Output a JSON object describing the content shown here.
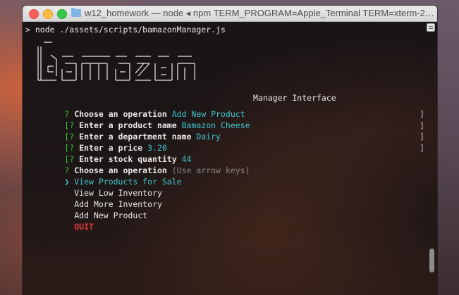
{
  "window": {
    "title": "w12_homework — node ◂ npm TERM_PROGRAM=Apple_Terminal TERM=xterm-2…"
  },
  "terminal": {
    "command_line": "> node ./assets/scripts/bamazonManager.js",
    "banner_logo_text": "Bamazon",
    "banner_subtitle": "Manager Interface",
    "lines": [
      {
        "prefix": "? ",
        "label": "Choose an operation ",
        "answer": "Add New Product"
      },
      {
        "prefix": "[? ",
        "label": "Enter a product name ",
        "answer": "Bamazon Cheese",
        "suffix": "]"
      },
      {
        "prefix": "[? ",
        "label": "Enter a department name ",
        "answer": "Dairy",
        "suffix": "]"
      },
      {
        "prefix": "[? ",
        "label": "Enter a price ",
        "answer": "3.20",
        "suffix": "]"
      },
      {
        "prefix": "[? ",
        "label": "Enter stock quantity ",
        "answer": "44",
        "suffix": "]"
      }
    ],
    "prompt": {
      "prefix": "? ",
      "label": "Choose an operation ",
      "hint": "(Use arrow keys)"
    },
    "menu": [
      {
        "pointer": "❯ ",
        "label": "View Products for Sale",
        "selected": true
      },
      {
        "pointer": "  ",
        "label": "View Low Inventory",
        "selected": false
      },
      {
        "pointer": "  ",
        "label": "Add More Inventory",
        "selected": false
      },
      {
        "pointer": "  ",
        "label": "Add New Product",
        "selected": false
      },
      {
        "pointer": "  ",
        "label": "QUIT",
        "selected": false
      }
    ]
  },
  "colors": {
    "accent_cyan": "#3fc4cf",
    "prompt_green": "#39c339",
    "quit_red": "#e03a3a"
  }
}
